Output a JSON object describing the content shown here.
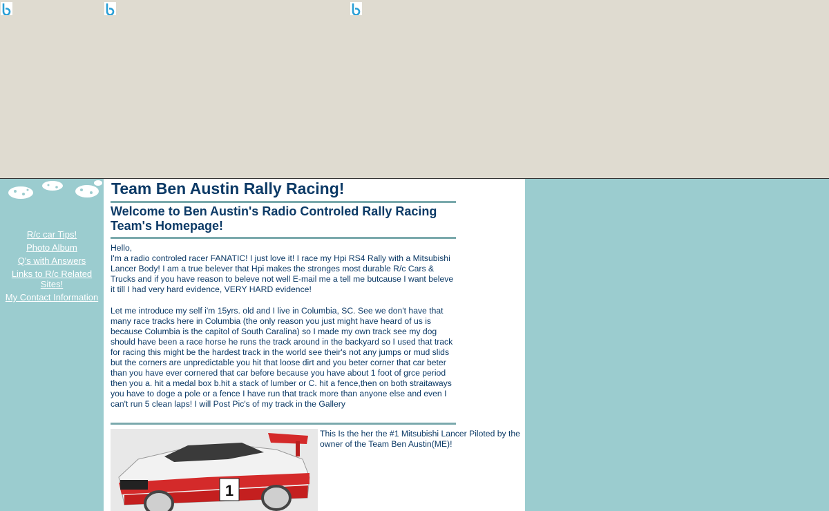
{
  "ads": {
    "icon": "ad-choices-b-icon",
    "count": 3
  },
  "sidebar": {
    "nav": [
      {
        "label": "R/c car Tips!"
      },
      {
        "label": "Photo Album"
      },
      {
        "label": "Q's with Answers"
      },
      {
        "label": "Links to R/c Related Sites!"
      },
      {
        "label": "My Contact Information"
      }
    ]
  },
  "main": {
    "title": "Team Ben Austin Rally Racing!",
    "subtitle": "Welcome to Ben Austin's Radio Controled Rally Racing Team's Homepage!",
    "greeting": "Hello,",
    "para1": "I'm a radio controled racer FANATIC! I just love it! I race my Hpi RS4 Rally with a Mitsubishi Lancer Body! I am a true belever that Hpi makes the stronges most durable R/c Cars & Trucks and if you have reason to beleve not well E-mail me a tell me butcause I want beleve it till I had very hard evidence, VERY HARD evidence!",
    "para2": "Let me introduce my self i'm 15yrs. old and I live in Columbia, SC. See we don't have that many race tracks here in Columbia (the only reason you just might have heard of us is because Columbia is the capitol of South Caralina) so I made my own track see my dog should have been a race horse he runs the track around in the backyard so I used that track for racing this might be the hardest track in the world see their's not any jumps or mud slids but the corners are unpredictable you hit that loose dirt and you beter corner that car beter than you have ever cornered that car before because you have about 1 foot of grce period then you a. hit a medal box b.hit a stack of lumber or C. hit a fence,then on both straitaways you have to doge a pole or a fence I have run that track more than anyone else and even I can't run 5 clean laps! I will Post Pic's of my track in the Gallery",
    "caption": "This Is the her the #1 Mitsubishi Lancer Piloted by the owner of the Team Ben Austin(ME)!",
    "car_number": "1"
  },
  "colors": {
    "page_bg": "#9bcccf",
    "banner_bg": "#dfdbd0",
    "heading": "#0c3a66",
    "rule": "#7aa9ac"
  }
}
